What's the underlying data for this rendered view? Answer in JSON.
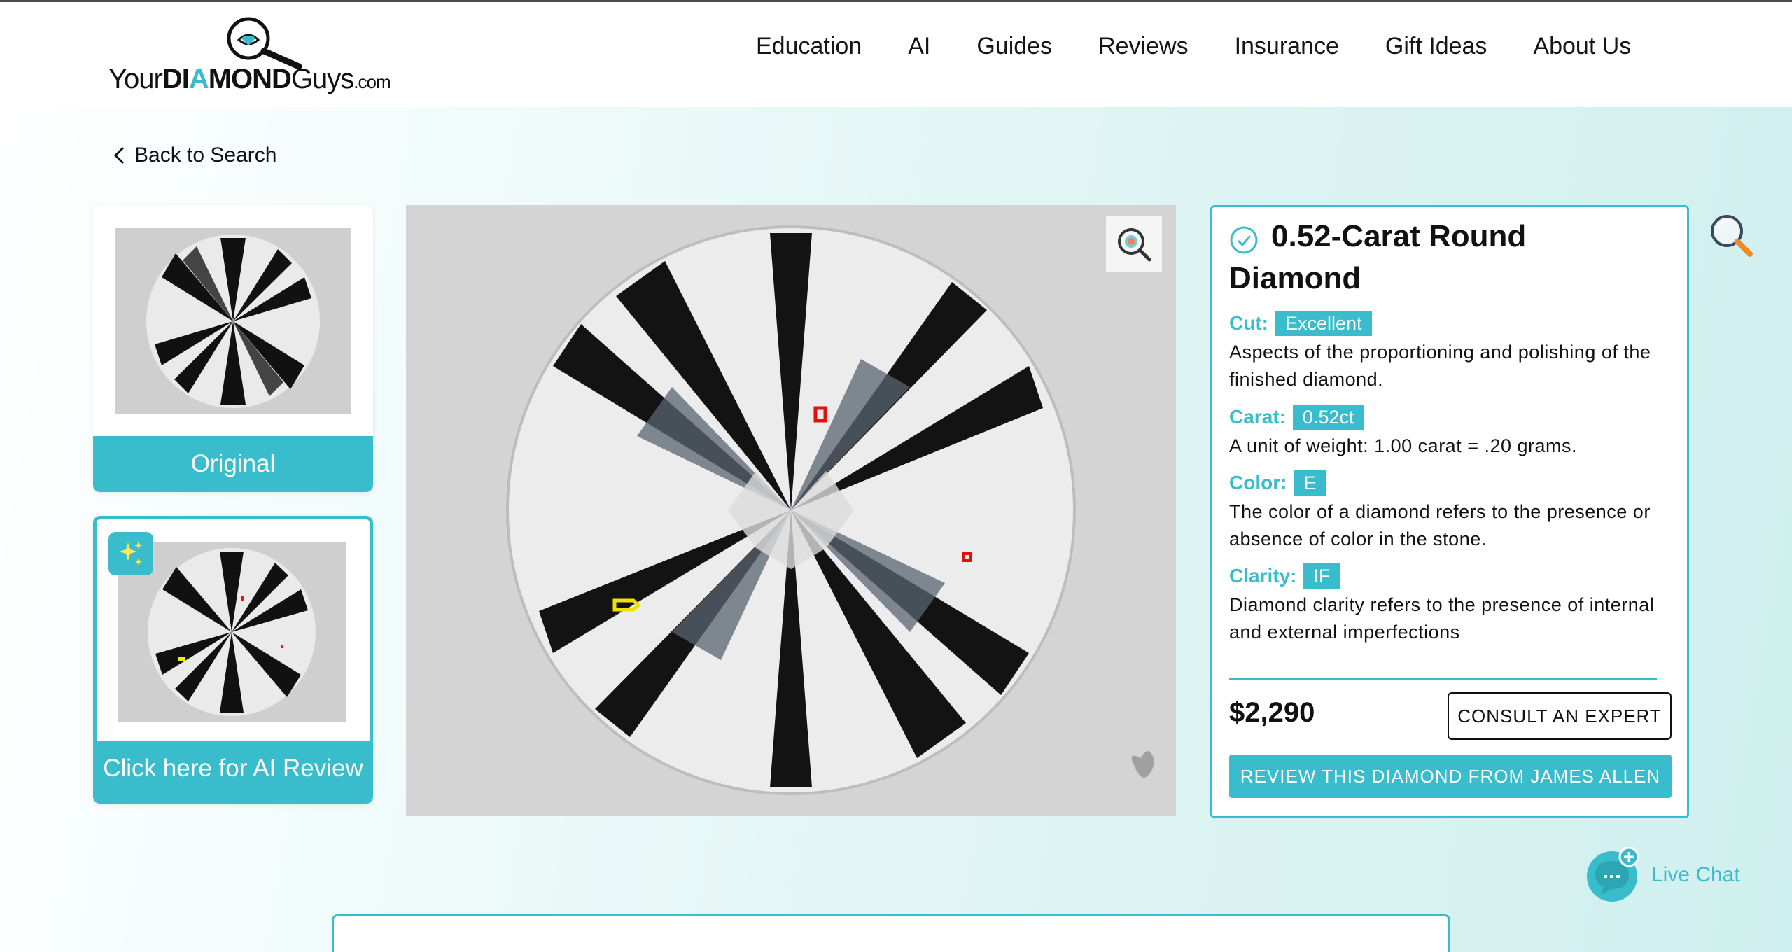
{
  "brand": {
    "logo_text_1": "Your",
    "logo_text_2": "DI",
    "logo_text_ai": "A",
    "logo_text_3": "MOND",
    "logo_text_4": "Guys",
    "logo_text_5": ".com",
    "accent_color": "#39bccb"
  },
  "nav": {
    "items": [
      {
        "label": "Education"
      },
      {
        "label": "AI"
      },
      {
        "label": "Guides"
      },
      {
        "label": "Reviews"
      },
      {
        "label": "Insurance"
      },
      {
        "label": "Gift Ideas"
      },
      {
        "label": "About Us"
      }
    ]
  },
  "back": {
    "label": "Back to Search"
  },
  "thumbnails": {
    "original_label": "Original",
    "ai_label": "Click here for AI Review"
  },
  "product": {
    "title": "0.52-Carat Round Diamond",
    "attributes": [
      {
        "label": "Cut:",
        "value": "Excellent",
        "desc": "Aspects of the proportioning and polishing of the finished diamond."
      },
      {
        "label": "Carat:",
        "value": "0.52ct",
        "desc": "A unit of weight: 1.00 carat = .20 grams."
      },
      {
        "label": "Color:",
        "value": "E",
        "desc": "The color of a diamond refers to the presence or absence of color in the stone."
      },
      {
        "label": "Clarity:",
        "value": "IF",
        "desc": "Diamond clarity refers to the presence of internal and external imperfections"
      }
    ],
    "price": "$2,290",
    "consult_label": "CONSULT AN EXPERT",
    "review_label": "REVIEW THIS DIAMOND FROM JAMES ALLEN"
  },
  "chat": {
    "label": "Live Chat"
  },
  "icons": {
    "zoom": "zoom-icon",
    "check": "check-circle-icon",
    "search": "search-icon",
    "sparkle": "sparkle-icon",
    "chat": "chat-icon",
    "back": "chevron-left-icon"
  }
}
